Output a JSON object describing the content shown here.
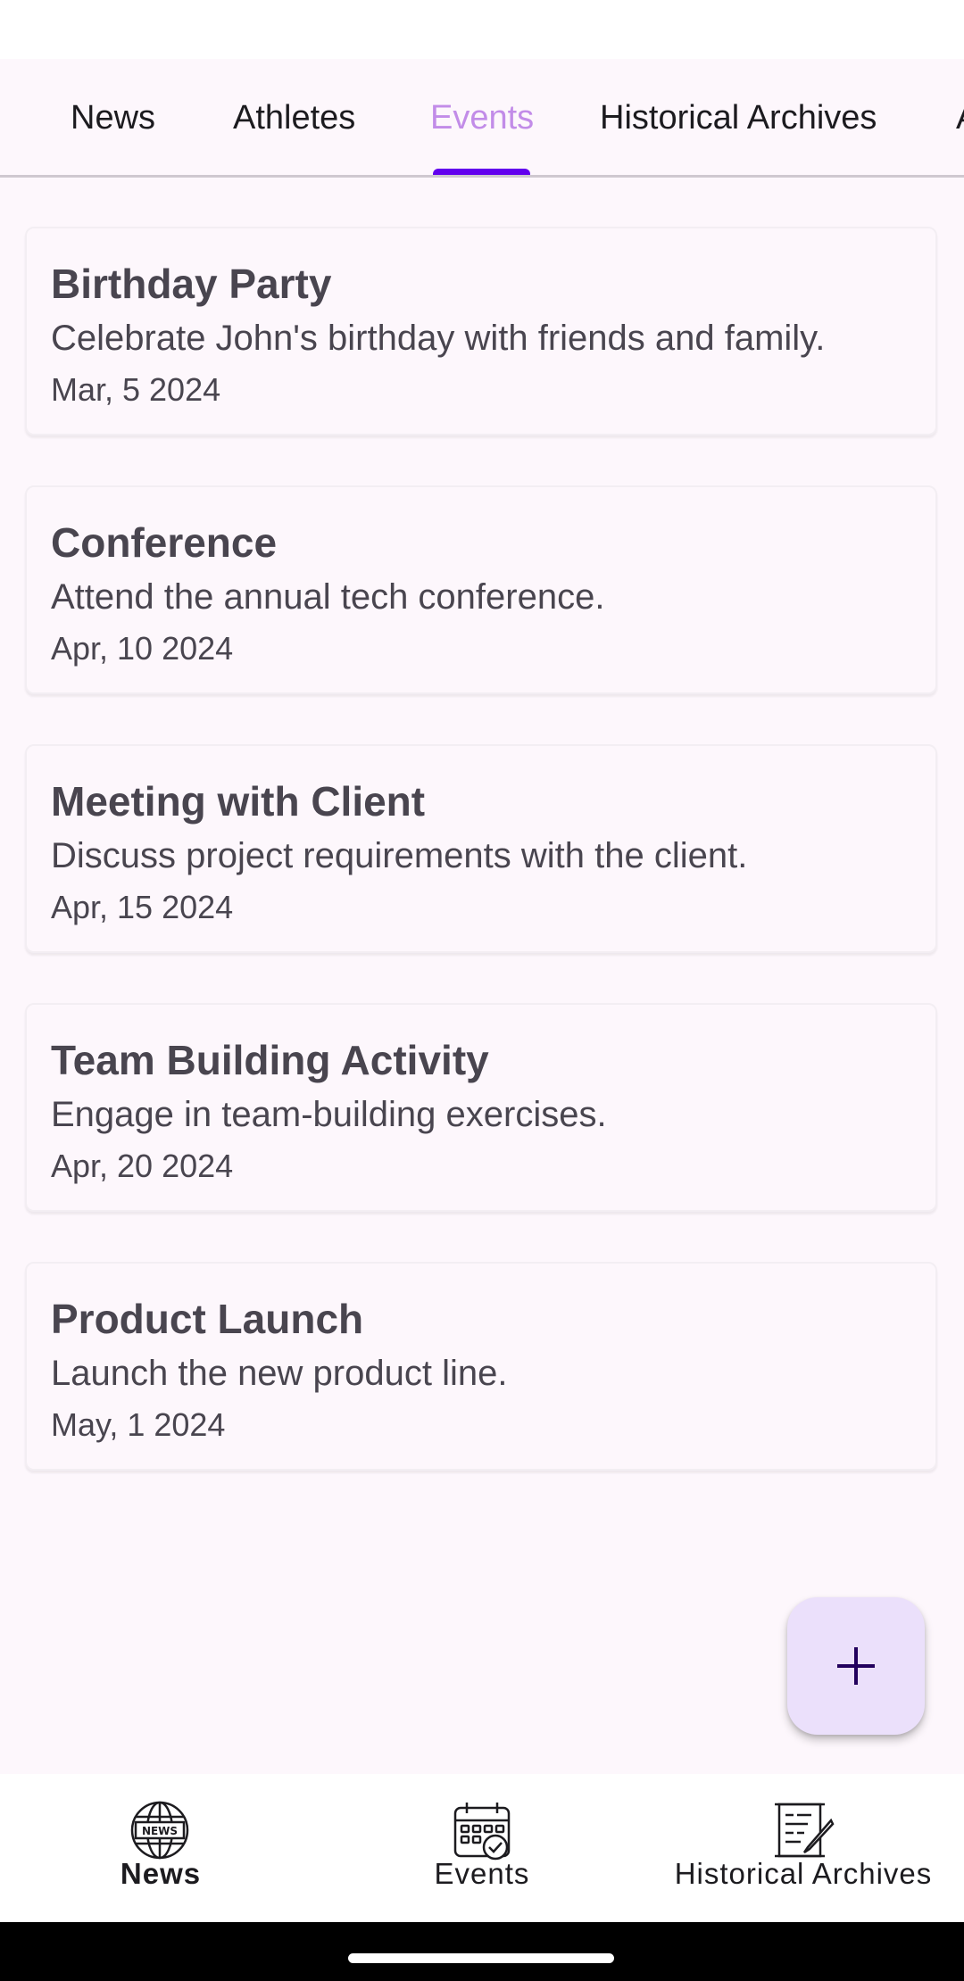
{
  "tabs": [
    {
      "label": "News"
    },
    {
      "label": "Athletes"
    },
    {
      "label": "Events"
    },
    {
      "label": "Historical Archives"
    },
    {
      "label": "A"
    }
  ],
  "active_tab": "Events",
  "events": [
    {
      "title": "Birthday Party",
      "description": "Celebrate John's birthday with friends and family.",
      "date": "Mar, 5 2024"
    },
    {
      "title": "Conference",
      "description": "Attend the annual tech conference.",
      "date": "Apr, 10 2024"
    },
    {
      "title": "Meeting with Client",
      "description": "Discuss project requirements with the client.",
      "date": "Apr, 15 2024"
    },
    {
      "title": "Team Building Activity",
      "description": "Engage in team-building exercises.",
      "date": "Apr, 20 2024"
    },
    {
      "title": "Product Launch",
      "description": "Launch the new product line.",
      "date": "May, 1 2024"
    }
  ],
  "fab": {
    "icon": "plus-icon"
  },
  "bottom_nav": [
    {
      "label": "News",
      "icon": "news-globe-icon"
    },
    {
      "label": "Events",
      "icon": "calendar-check-icon"
    },
    {
      "label": "Historical Archives",
      "icon": "scroll-quill-icon"
    }
  ],
  "colors": {
    "background": "#fdf7fc",
    "active_tab_text": "#c28ce8",
    "tab_indicator": "#6200ee",
    "card_text": "#49454f",
    "fab_background": "#ebe0fb"
  }
}
